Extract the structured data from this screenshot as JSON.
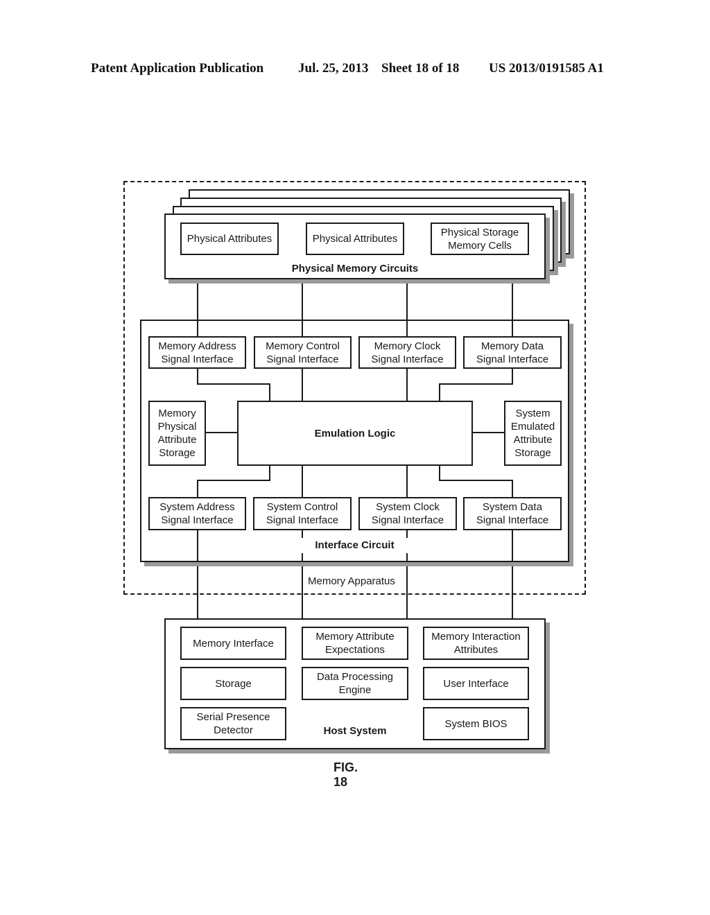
{
  "header": {
    "publication": "Patent Application Publication",
    "date": "Jul. 25, 2013",
    "sheet": "Sheet 18 of 18",
    "number": "US 2013/0191585 A1"
  },
  "memory_apparatus": {
    "label": "Memory Apparatus",
    "physical_memory_circuits": {
      "title": "Physical Memory Circuits",
      "stack_count": 4,
      "items": [
        "Physical Attributes",
        "Physical Attributes",
        "Physical Storage\nMemory Cells"
      ]
    },
    "interface_circuit": {
      "title": "Interface Circuit",
      "memory_interfaces": [
        "Memory Address\nSignal Interface",
        "Memory Control\nSignal Interface",
        "Memory Clock\nSignal Interface",
        "Memory Data\nSignal Interface"
      ],
      "left_storage": "Memory\nPhysical\nAttribute\nStorage",
      "emulation_logic": "Emulation Logic",
      "right_storage": "System\nEmulated\nAttribute\nStorage",
      "system_interfaces": [
        "System Address\nSignal Interface",
        "System Control\nSignal Interface",
        "System Clock\nSignal Interface",
        "System Data\nSignal Interface"
      ]
    }
  },
  "host_system": {
    "title": "Host System",
    "items": [
      "Memory Interface",
      "Memory Attribute\nExpectations",
      "Memory Interaction\nAttributes",
      "Storage",
      "Data Processing\nEngine",
      "User Interface",
      "Serial Presence\nDetector",
      "System BIOS"
    ]
  },
  "figure_label": "FIG. 18"
}
